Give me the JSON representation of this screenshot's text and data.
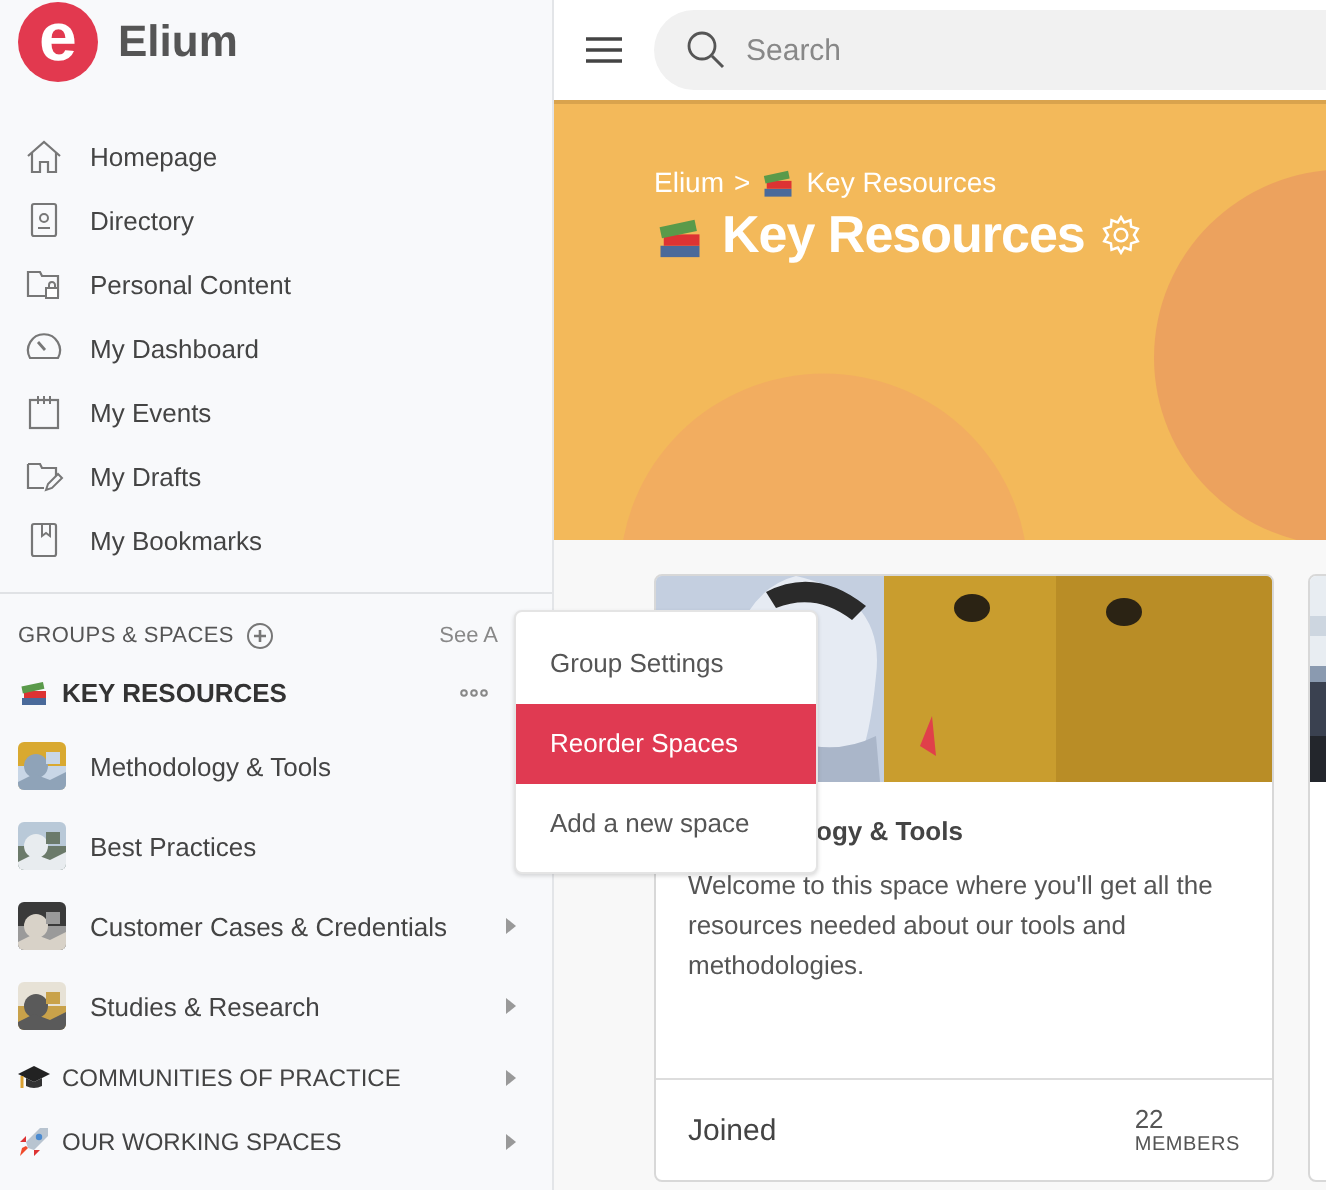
{
  "brand": {
    "logo_letter": "e",
    "name": "Elium"
  },
  "nav": [
    {
      "label": "Homepage",
      "kind": "home"
    },
    {
      "label": "Directory",
      "kind": "directory"
    },
    {
      "label": "Personal Content",
      "kind": "folder-lock"
    },
    {
      "label": "My Dashboard",
      "kind": "gauge"
    },
    {
      "label": "My Events",
      "kind": "calendar"
    },
    {
      "label": "My Drafts",
      "kind": "folder-pen"
    },
    {
      "label": "My Bookmarks",
      "kind": "bookmark"
    }
  ],
  "groups": {
    "heading": "GROUPS & SPACES",
    "see_all": "See A",
    "group": {
      "label": "KEY RESOURCES"
    },
    "spaces": [
      {
        "label": "Methodology & Tools",
        "has_children": false
      },
      {
        "label": "Best Practices",
        "has_children": false
      },
      {
        "label": "Customer Cases & Credentials",
        "has_children": true
      },
      {
        "label": "Studies & Research",
        "has_children": true
      }
    ],
    "sections": [
      {
        "label": "COMMUNITIES OF PRACTICE",
        "kind": "grad-cap",
        "has_children": true
      },
      {
        "label": "OUR WORKING SPACES",
        "kind": "rocket",
        "has_children": true
      }
    ]
  },
  "search": {
    "placeholder": "Search"
  },
  "banner": {
    "breadcrumb": [
      "Elium",
      ">",
      "Key Resources"
    ],
    "title": "Key Resources"
  },
  "menu": [
    {
      "label": "Group Settings",
      "selected": false
    },
    {
      "label": "Reorder Spaces",
      "selected": true
    },
    {
      "label": "Add a new space",
      "selected": false
    }
  ],
  "cards": [
    {
      "kind": "space",
      "title": "ogy & Tools",
      "description": "Welcome to this space where you'll get all the resources needed about our tools and methodologies.",
      "status": "Joined",
      "member_count": "22",
      "member_label": "MEMBERS"
    },
    {
      "kind": "picture"
    }
  ]
}
